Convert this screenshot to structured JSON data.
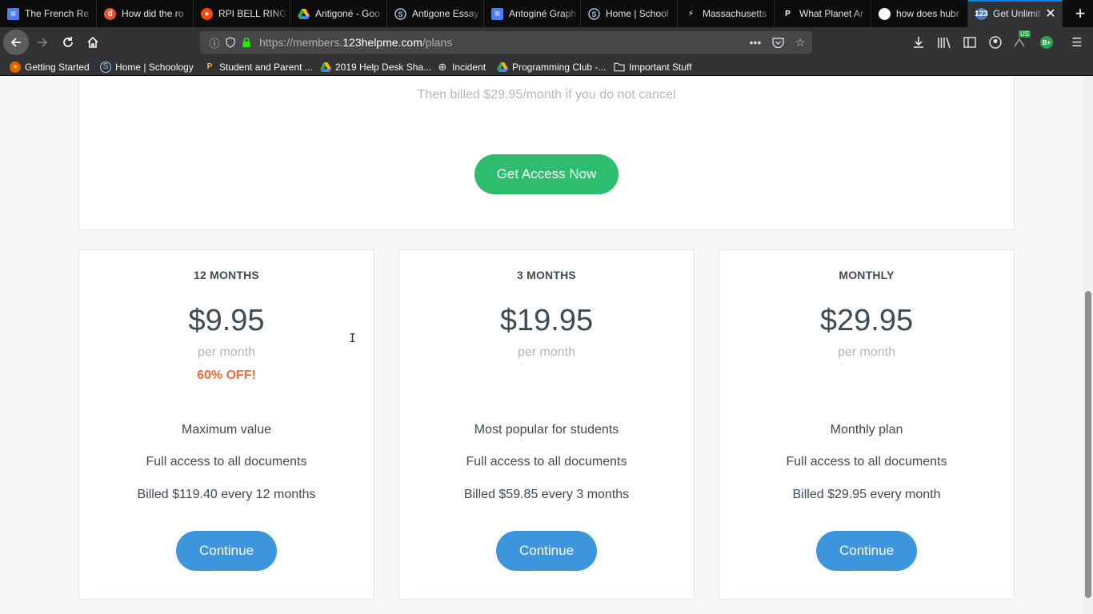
{
  "browser": {
    "tabs": [
      {
        "title": "The French Re",
        "icon": "google-docs-icon"
      },
      {
        "title": "How did the ro",
        "icon": "duckduckgo-icon"
      },
      {
        "title": "RPI BELL RING",
        "icon": "reddit-icon"
      },
      {
        "title": "Antigoné - Goo",
        "icon": "google-drive-icon"
      },
      {
        "title": "Antigone Essay",
        "icon": "schoology-icon"
      },
      {
        "title": "Antoginé Graph",
        "icon": "google-docs-icon"
      },
      {
        "title": "Home | School",
        "icon": "schoology-icon"
      },
      {
        "title": "Massachusetts",
        "icon": "mass-icon"
      },
      {
        "title": "What Planet Ar",
        "icon": "pp-icon"
      },
      {
        "title": "how does hubr",
        "icon": "google-icon"
      },
      {
        "title": "Get Unlimit",
        "icon": "123helpme-icon",
        "active": true
      }
    ],
    "url": {
      "prefix": "https://members.",
      "host": "123helpme.com",
      "path": "/plans"
    },
    "extension_badges": {
      "us": "US",
      "b": "B+"
    },
    "bookmarks": [
      {
        "label": "Getting Started",
        "icon": "firefox-icon"
      },
      {
        "label": "Home | Schoology",
        "icon": "schoology-icon"
      },
      {
        "label": "Student and Parent ...",
        "icon": "powerschool-icon"
      },
      {
        "label": "2019 Help Desk Sha...",
        "icon": "google-drive-icon"
      },
      {
        "label": "Incident",
        "icon": "globe-icon"
      },
      {
        "label": "Programming Club -...",
        "icon": "google-drive-icon"
      },
      {
        "label": "Important Stuff",
        "icon": "folder-icon"
      }
    ]
  },
  "page": {
    "billing_note": "Then billed $29.95/month if you do not cancel",
    "access_button": "Get Access Now",
    "plans": [
      {
        "name": "12 MONTHS",
        "price": "$9.95",
        "per": "per month",
        "discount": "60% OFF!",
        "tagline": "Maximum value",
        "access": "Full access to all documents",
        "billing": "Billed $119.40 every 12 months",
        "button": "Continue"
      },
      {
        "name": "3 MONTHS",
        "price": "$19.95",
        "per": "per month",
        "discount": "",
        "tagline": "Most popular for students",
        "access": "Full access to all documents",
        "billing": "Billed $59.85 every 3 months",
        "button": "Continue"
      },
      {
        "name": "MONTHLY",
        "price": "$29.95",
        "per": "per month",
        "discount": "",
        "tagline": "Monthly plan",
        "access": "Full access to all documents",
        "billing": "Billed $29.95 every month",
        "button": "Continue"
      }
    ]
  },
  "colors": {
    "accent_green": "#2ebd6e",
    "button_blue": "#3d96dc",
    "discount_orange": "#f06b35"
  }
}
